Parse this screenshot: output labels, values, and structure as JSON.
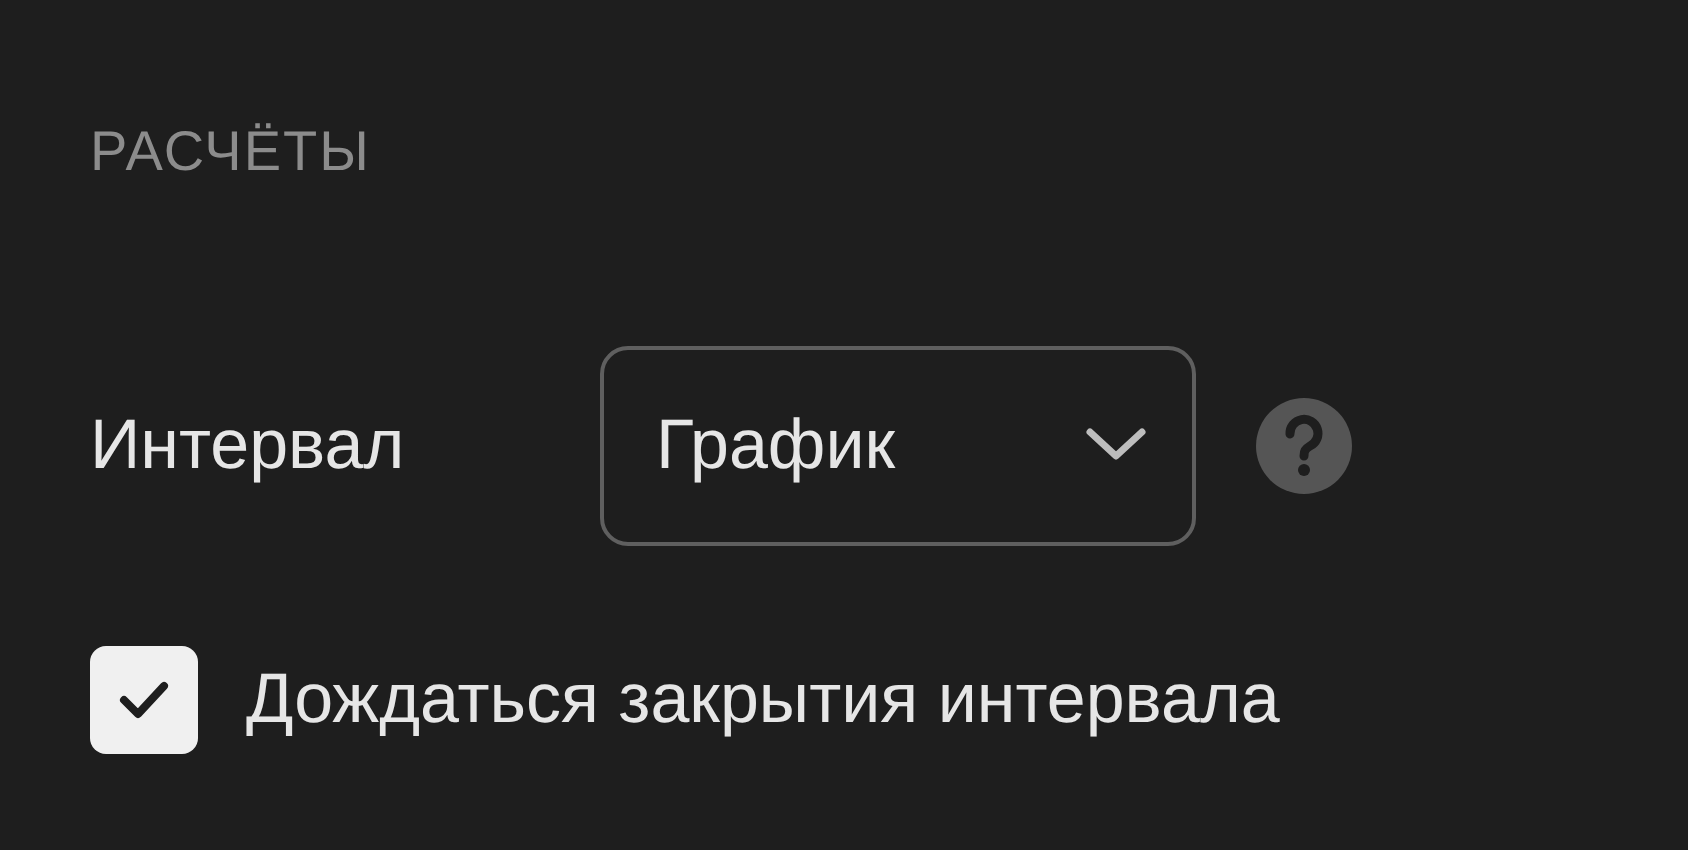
{
  "section": {
    "title": "РАСЧЁТЫ"
  },
  "interval": {
    "label": "Интервал",
    "value": "График"
  },
  "wait_checkbox": {
    "label": "Дождаться закрытия интервала",
    "checked": true
  }
}
